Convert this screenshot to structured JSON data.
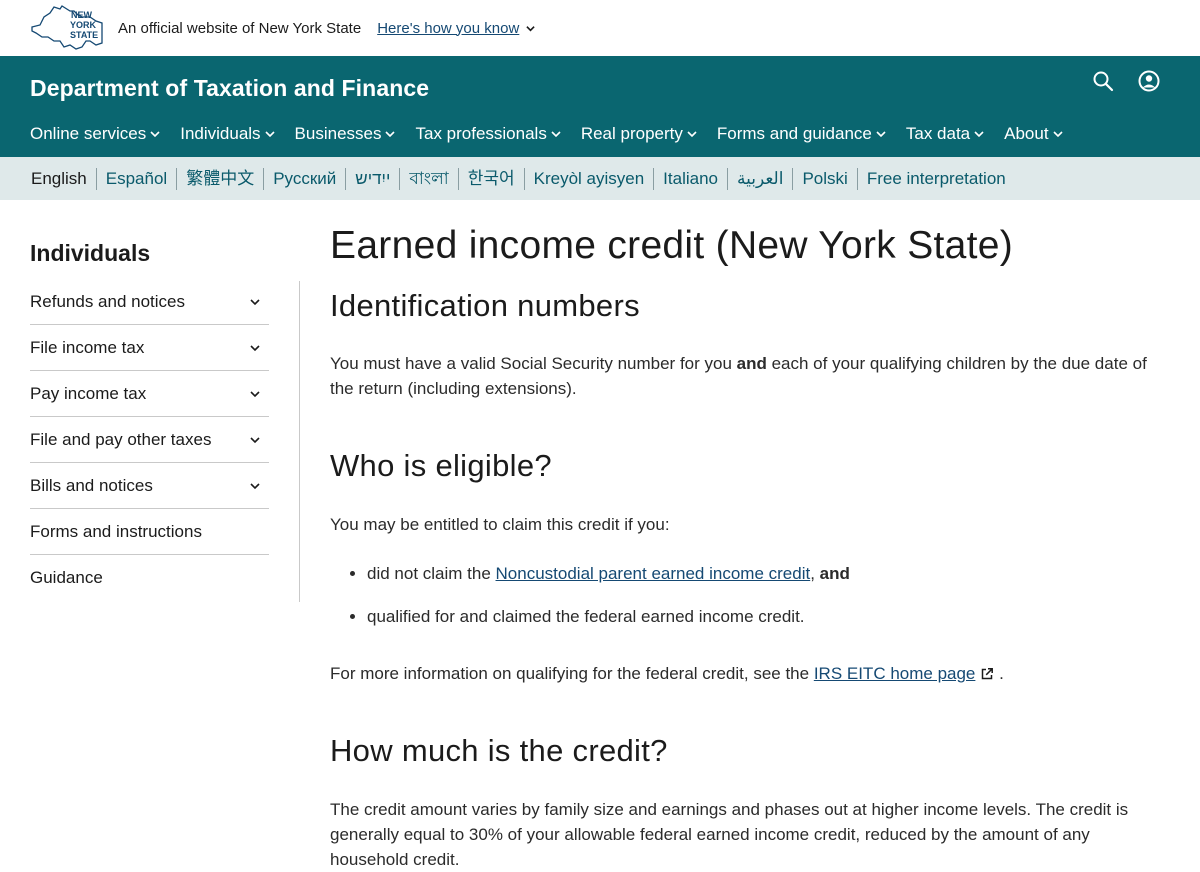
{
  "banner": {
    "logo_text": [
      "NEW",
      "YORK",
      "STATE"
    ],
    "official_text": "An official website of New York State",
    "how_know": "Here's how you know"
  },
  "header": {
    "title": "Department of Taxation and Finance",
    "nav": [
      {
        "label": "Online services"
      },
      {
        "label": "Individuals"
      },
      {
        "label": "Businesses"
      },
      {
        "label": "Tax professionals"
      },
      {
        "label": "Real property"
      },
      {
        "label": "Forms and guidance"
      },
      {
        "label": "Tax data"
      },
      {
        "label": "About"
      }
    ],
    "icons": [
      "search-icon",
      "user-account-icon"
    ]
  },
  "languages": [
    "English",
    "Español",
    "繁體中文",
    "Русский",
    "ייִדיש",
    "বাংলা",
    "한국어",
    "Kreyòl ayisyen",
    "Italiano",
    "العربية",
    "Polski",
    "Free interpretation"
  ],
  "sidebar": {
    "title": "Individuals",
    "items": [
      {
        "label": "Refunds and notices",
        "expandable": true
      },
      {
        "label": "File income tax",
        "expandable": true
      },
      {
        "label": "Pay income tax",
        "expandable": true
      },
      {
        "label": "File and pay other taxes",
        "expandable": true
      },
      {
        "label": "Bills and notices",
        "expandable": true
      },
      {
        "label": "Forms and instructions",
        "expandable": false
      },
      {
        "label": "Guidance",
        "expandable": false
      }
    ]
  },
  "main": {
    "title": "Earned income credit (New York State)",
    "id_heading": "Identification numbers",
    "id_para_1": "You must have a valid Social Security number for you ",
    "id_para_bold": "and",
    "id_para_2": " each of your qualifying children by the due date of the return (including extensions).",
    "eligible_heading": "Who is eligible?",
    "eligible_intro": "You may be entitled to claim this credit if you:",
    "bullet1_pre": "did not claim the ",
    "bullet1_link": "Noncustodial parent earned income credit",
    "bullet1_sep": ", ",
    "bullet1_bold": "and",
    "bullet2": "qualified for and claimed the federal earned income credit.",
    "more_info_pre": "For more information on qualifying for the federal credit, see the ",
    "more_info_link": "IRS EITC home page",
    "more_info_post": " .",
    "credit_heading": "How much is the credit?",
    "credit_para": "The credit amount varies by family size and earnings and phases out at higher income levels. The credit is generally equal to 30% of your allowable federal earned income credit, reduced by the amount of any household credit."
  },
  "colors": {
    "header_bg": "#0a6670",
    "lang_bar_bg": "#dfe9ea",
    "link": "#154973"
  }
}
